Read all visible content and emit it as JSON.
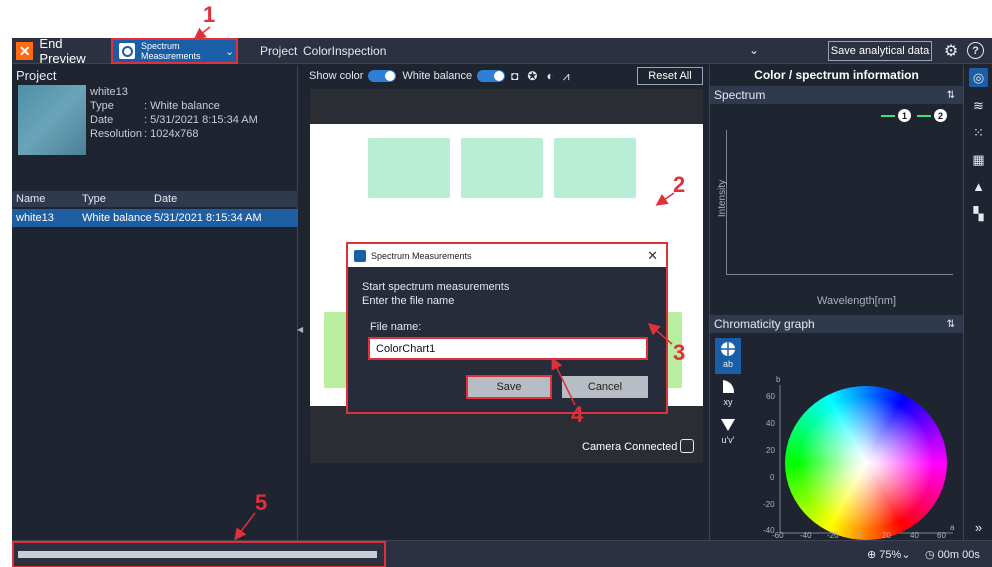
{
  "topbar": {
    "end_preview": "End Preview",
    "mode_label": "Spectrum\nMeasurements",
    "project_label": "Project",
    "project_name": "ColorInspection",
    "save_analytical": "Save analytical data"
  },
  "left": {
    "title": "Project",
    "item_name": "white13",
    "meta": [
      {
        "key": "Type",
        "value": ": White balance"
      },
      {
        "key": "Date",
        "value": ": 5/31/2021 8:15:34 AM"
      },
      {
        "key": "Resolution",
        "value": ": 1024x768"
      }
    ],
    "columns": [
      "Name",
      "Type",
      "Date"
    ],
    "rows": [
      {
        "name": "white13",
        "type": "White balance",
        "date": "5/31/2021 8:15:34 AM"
      }
    ]
  },
  "center": {
    "show_color": "Show color",
    "white_balance": "White balance",
    "reset_all": "Reset All",
    "camera_status": "Camera Connected"
  },
  "dialog": {
    "title": "Spectrum Measurements",
    "line1": "Start spectrum measurements",
    "line2": "Enter the file name",
    "file_label": "File name:",
    "file_value": "ColorChart1",
    "save": "Save",
    "cancel": "Cancel"
  },
  "right": {
    "title": "Color / spectrum information",
    "spectrum": "Spectrum",
    "legend": [
      "1",
      "2"
    ],
    "y_label": "Intensity",
    "x_label": "Wavelength[nm]",
    "chromaticity": "Chromaticity graph",
    "modes": [
      "ab",
      "xy",
      "u'v'"
    ],
    "axis_b": "b",
    "axis_a": "a",
    "y_ticks": [
      "60",
      "40",
      "20",
      "0",
      "-20",
      "-40",
      "-60"
    ],
    "x_ticks": [
      "-60",
      "-40",
      "-20",
      "0",
      "20",
      "40",
      "60"
    ]
  },
  "status": {
    "zoom": "75%",
    "timer": "00m 00s"
  },
  "annotations": [
    "1",
    "2",
    "3",
    "4",
    "5"
  ],
  "colors": {
    "accent": "#1a5ea8",
    "annotation": "#e0303a",
    "end_preview": "#ff6a13"
  }
}
